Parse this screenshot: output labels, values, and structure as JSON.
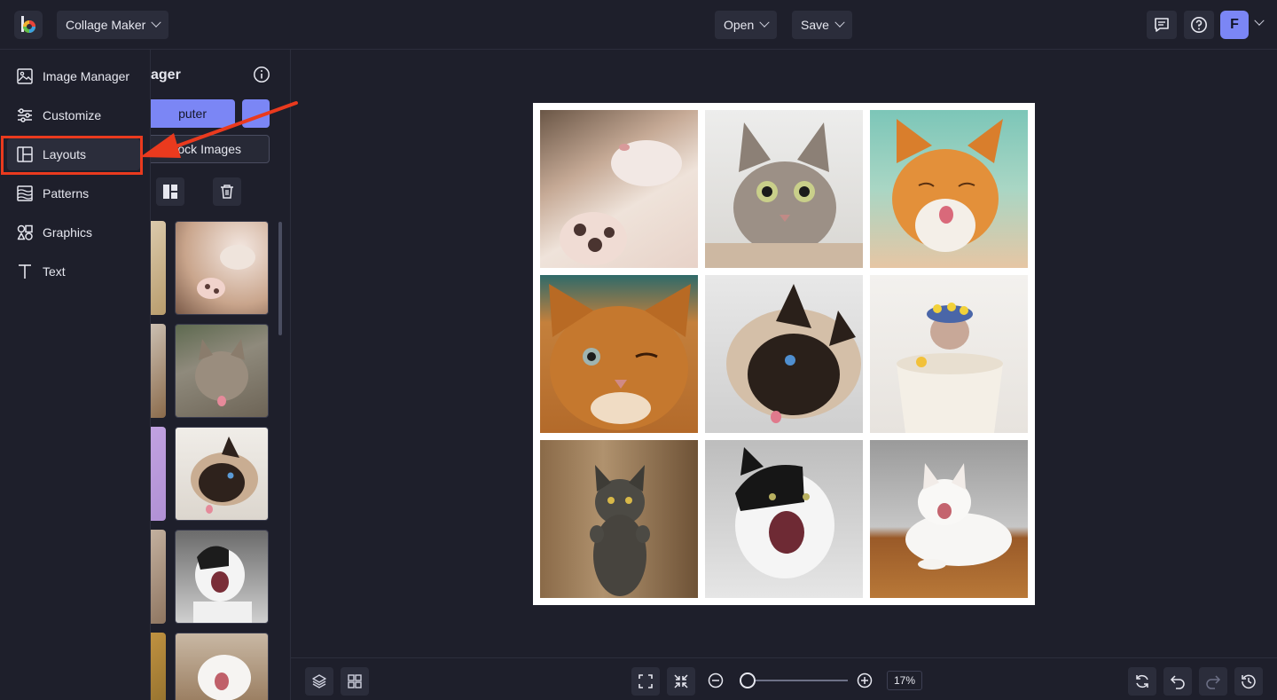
{
  "header": {
    "app_menu_label": "Collage Maker",
    "open_label": "Open",
    "save_label": "Save",
    "avatar_letter": "F",
    "icons": [
      "logo-icon",
      "chat-icon",
      "help-icon",
      "chevron-down-icon"
    ]
  },
  "left_menu": {
    "items": [
      {
        "label": "Image Manager",
        "icon": "image-icon"
      },
      {
        "label": "Customize",
        "icon": "sliders-icon"
      },
      {
        "label": "Layouts",
        "icon": "layout-icon",
        "active": true
      },
      {
        "label": "Patterns",
        "icon": "patterns-icon"
      },
      {
        "label": "Graphics",
        "icon": "shapes-icon"
      },
      {
        "label": "Text",
        "icon": "text-icon"
      }
    ]
  },
  "panel": {
    "title_partial": "ager",
    "computer_button_partial": "puter",
    "stock_button_partial": "Stock Images"
  },
  "canvas": {
    "cells": [
      "cat-sleeping-paws",
      "grey-cat-wide-eyes",
      "orange-cat-licking",
      "orange-cat-winking",
      "siamese-cat-tongue",
      "sphynx-cat-in-bucket",
      "grey-kitten-standing",
      "black-white-cat-meowing",
      "white-cat-yawning"
    ]
  },
  "bottom": {
    "zoom_value": "17%",
    "zoom_level": 0.17
  },
  "colors": {
    "accent": "#7b86f5",
    "background": "#1e1f2b",
    "highlight": "#ea3a1e"
  }
}
